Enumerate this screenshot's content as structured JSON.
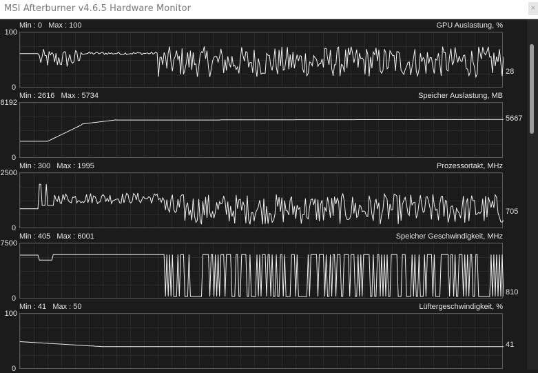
{
  "window": {
    "title": "MSI Afterburner v4.6.5 Hardware Monitor",
    "close_glyph": "×"
  },
  "graphs": [
    {
      "name": "GPU Auslastung, %",
      "min_label": "Min : 0",
      "max_label": "Max : 100",
      "y_max": "100",
      "y_min": "0",
      "current": "28",
      "range": [
        0,
        100
      ]
    },
    {
      "name": "Speicher Auslastung, MB",
      "min_label": "Min : 2616",
      "max_label": "Max : 5734",
      "y_max": "8192",
      "y_min": "0",
      "current": "5667",
      "range": [
        0,
        8192
      ]
    },
    {
      "name": "Prozessortakt, MHz",
      "min_label": "Min : 300",
      "max_label": "Max : 1995",
      "y_max": "2500",
      "y_min": "0",
      "current": "705",
      "range": [
        0,
        2500
      ]
    },
    {
      "name": "Speicher Geschwindigkeit, MHz",
      "min_label": "Min : 405",
      "max_label": "Max : 6001",
      "y_max": "7500",
      "y_min": "0",
      "current": "810",
      "range": [
        0,
        7500
      ]
    },
    {
      "name": "Lüftergeschwindigkeit, %",
      "min_label": "Min : 41",
      "max_label": "Max : 50",
      "y_max": "100",
      "y_min": "0",
      "current": "41",
      "range": [
        0,
        100
      ]
    }
  ],
  "colors": {
    "line": "#f2f2f2",
    "grid": "#2a2a2a",
    "background": "#1b1b1b",
    "text": "#e4e4e4"
  }
}
